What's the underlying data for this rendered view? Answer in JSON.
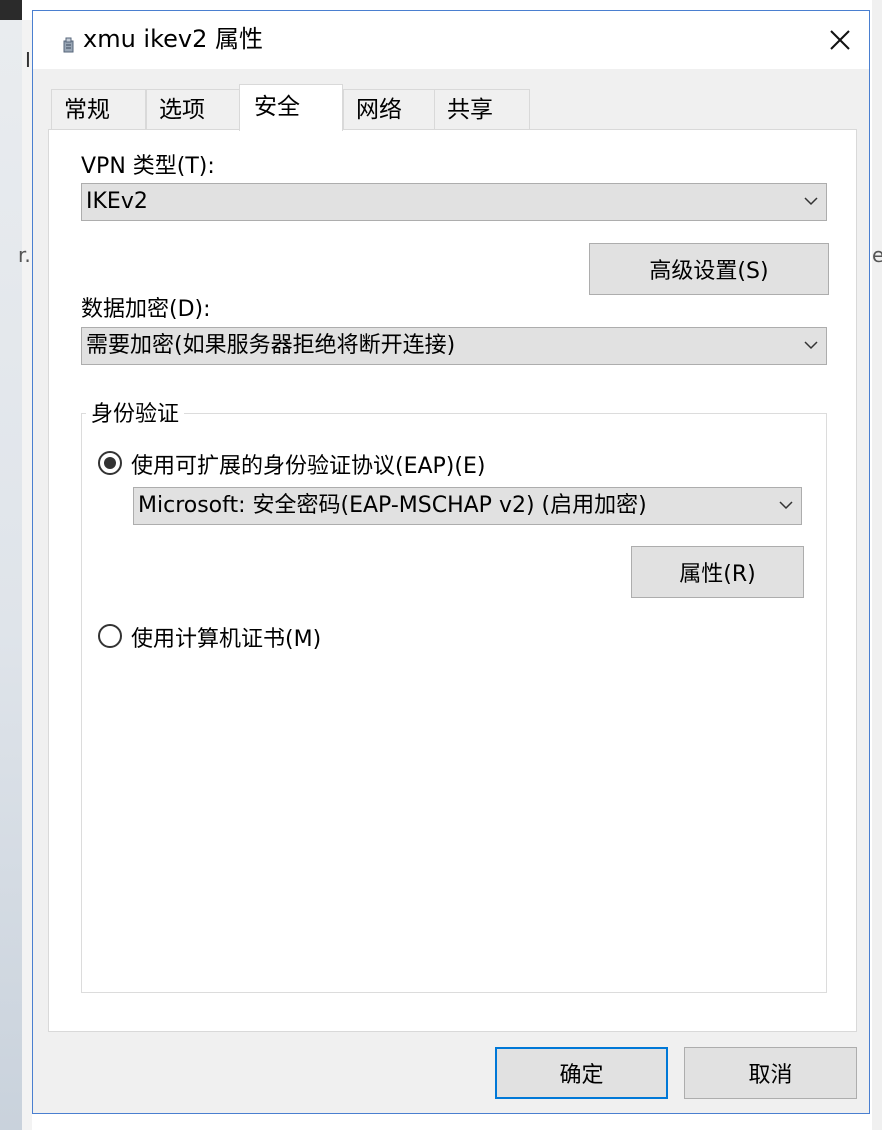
{
  "window": {
    "title": "xmu ikev2 属性",
    "app_icon": "vpn-connection-icon",
    "close_icon": "close-icon"
  },
  "background": {
    "frag_left_top": "I",
    "frag_left_mid": "r.",
    "frag_right_mid": "e"
  },
  "tabs": [
    {
      "label": "常规",
      "active": false
    },
    {
      "label": "选项",
      "active": false
    },
    {
      "label": "安全",
      "active": true
    },
    {
      "label": "网络",
      "active": false
    },
    {
      "label": "共享",
      "active": false
    }
  ],
  "security": {
    "vpn_type_label": "VPN 类型(T):",
    "vpn_type_value": "IKEv2",
    "advanced_button": "高级设置(S)",
    "encryption_label": "数据加密(D):",
    "encryption_value": "需要加密(如果服务器拒绝将断开连接)",
    "auth_group_title": "身份验证",
    "eap_radio_label": "使用可扩展的身份验证协议(EAP)(E)",
    "eap_selected": true,
    "eap_method_value": "Microsoft: 安全密码(EAP-MSCHAP v2) (启用加密)",
    "properties_button": "属性(R)",
    "cert_radio_label": "使用计算机证书(M)",
    "cert_selected": false
  },
  "footer": {
    "ok_button": "确定",
    "cancel_button": "取消"
  },
  "colors": {
    "dialog_border": "#4a7fd0",
    "default_button_border": "#0078d7",
    "control_face": "#e1e1e1"
  }
}
